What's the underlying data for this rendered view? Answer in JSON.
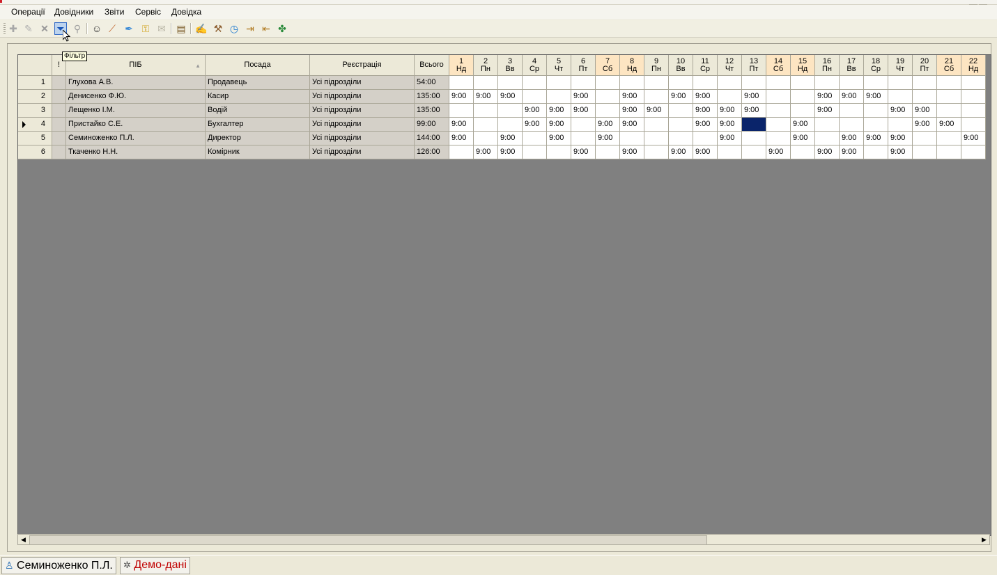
{
  "menu": [
    "Операції",
    "Довідники",
    "Звіти",
    "Сервіс",
    "Довідка"
  ],
  "tooltip": "Фільтр",
  "toolbar_icons": [
    "add-icon",
    "edit-icon",
    "delete-icon",
    "filter-icon",
    "clear-filter-icon",
    "users-icon",
    "brush-icon",
    "pin-icon",
    "key-icon",
    "mail-icon",
    "report-icon",
    "settings-icon",
    "tools-icon",
    "clock-icon",
    "export-icon",
    "import-icon",
    "plugin-icon"
  ],
  "columns": {
    "mark": "!",
    "name": "ПІБ",
    "position": "Посада",
    "registration": "Реєстрація",
    "total": "Всього"
  },
  "days": [
    {
      "d": "1",
      "w": "Нд",
      "weekend": true
    },
    {
      "d": "2",
      "w": "Пн",
      "weekend": false
    },
    {
      "d": "3",
      "w": "Вв",
      "weekend": false
    },
    {
      "d": "4",
      "w": "Ср",
      "weekend": false
    },
    {
      "d": "5",
      "w": "Чт",
      "weekend": false
    },
    {
      "d": "6",
      "w": "Пт",
      "weekend": false
    },
    {
      "d": "7",
      "w": "Сб",
      "weekend": true
    },
    {
      "d": "8",
      "w": "Нд",
      "weekend": true
    },
    {
      "d": "9",
      "w": "Пн",
      "weekend": false
    },
    {
      "d": "10",
      "w": "Вв",
      "weekend": false
    },
    {
      "d": "11",
      "w": "Ср",
      "weekend": false
    },
    {
      "d": "12",
      "w": "Чт",
      "weekend": false
    },
    {
      "d": "13",
      "w": "Пт",
      "weekend": false
    },
    {
      "d": "14",
      "w": "Сб",
      "weekend": true
    },
    {
      "d": "15",
      "w": "Нд",
      "weekend": true
    },
    {
      "d": "16",
      "w": "Пн",
      "weekend": false
    },
    {
      "d": "17",
      "w": "Вв",
      "weekend": false
    },
    {
      "d": "18",
      "w": "Ср",
      "weekend": false
    },
    {
      "d": "19",
      "w": "Чт",
      "weekend": false
    },
    {
      "d": "20",
      "w": "Пт",
      "weekend": false
    },
    {
      "d": "21",
      "w": "Сб",
      "weekend": true
    },
    {
      "d": "22",
      "w": "Нд",
      "weekend": true
    }
  ],
  "rows": [
    {
      "n": "1",
      "name": "Глухова А.В.",
      "position": "Продавець",
      "registration": "Усі підрозділи",
      "total": "54:00",
      "hours": [
        "",
        "",
        "",
        "",
        "",
        "",
        "",
        "",
        "",
        "",
        "",
        "",
        "",
        "",
        "",
        "",
        "",
        "",
        "",
        "",
        "",
        ""
      ]
    },
    {
      "n": "2",
      "name": "Денисенко Ф.Ю.",
      "position": "Касир",
      "registration": "Усі підрозділи",
      "total": "135:00",
      "hours": [
        "9:00",
        "9:00",
        "9:00",
        "",
        "",
        "9:00",
        "",
        "9:00",
        "",
        "9:00",
        "9:00",
        "",
        "9:00",
        "",
        "",
        "9:00",
        "9:00",
        "9:00",
        "",
        "",
        "",
        ""
      ]
    },
    {
      "n": "3",
      "name": "Лещенко І.М.",
      "position": "Водій",
      "registration": "Усі підрозділи",
      "total": "135:00",
      "hours": [
        "",
        "",
        "",
        "9:00",
        "9:00",
        "9:00",
        "",
        "9:00",
        "9:00",
        "",
        "9:00",
        "9:00",
        "9:00",
        "",
        "",
        "9:00",
        "",
        "",
        "9:00",
        "9:00",
        "",
        ""
      ]
    },
    {
      "n": "4",
      "name": "Пристайко С.Е.",
      "position": "Бухгалтер",
      "registration": "Усі підрозділи",
      "total": "99:00",
      "current": true,
      "hours": [
        "9:00",
        "",
        "",
        "9:00",
        "9:00",
        "",
        "9:00",
        "9:00",
        "",
        "",
        "9:00",
        "9:00",
        "",
        "",
        "9:00",
        "",
        "",
        "",
        "",
        "9:00",
        "9:00",
        ""
      ]
    },
    {
      "n": "5",
      "name": "Семиноженко П.Л.",
      "position": "Директор",
      "registration": "Усі підрозділи",
      "total": "144:00",
      "hours": [
        "9:00",
        "",
        "9:00",
        "",
        "9:00",
        "",
        "9:00",
        "",
        "",
        "",
        "",
        "9:00",
        "",
        "",
        "9:00",
        "",
        "9:00",
        "9:00",
        "9:00",
        "",
        "",
        "9:00"
      ]
    },
    {
      "n": "6",
      "name": "Ткаченко Н.Н.",
      "position": "Комірник",
      "registration": "Усі підрозділи",
      "total": "126:00",
      "hours": [
        "",
        "9:00",
        "9:00",
        "",
        "",
        "9:00",
        "",
        "9:00",
        "",
        "9:00",
        "9:00",
        "",
        "",
        "9:00",
        "",
        "9:00",
        "9:00",
        "",
        "9:00",
        "",
        "",
        ""
      ]
    }
  ],
  "status": {
    "user": "Семиноженко П.Л.",
    "mode": "Демо-дані",
    "mode_color": "#c00000"
  }
}
